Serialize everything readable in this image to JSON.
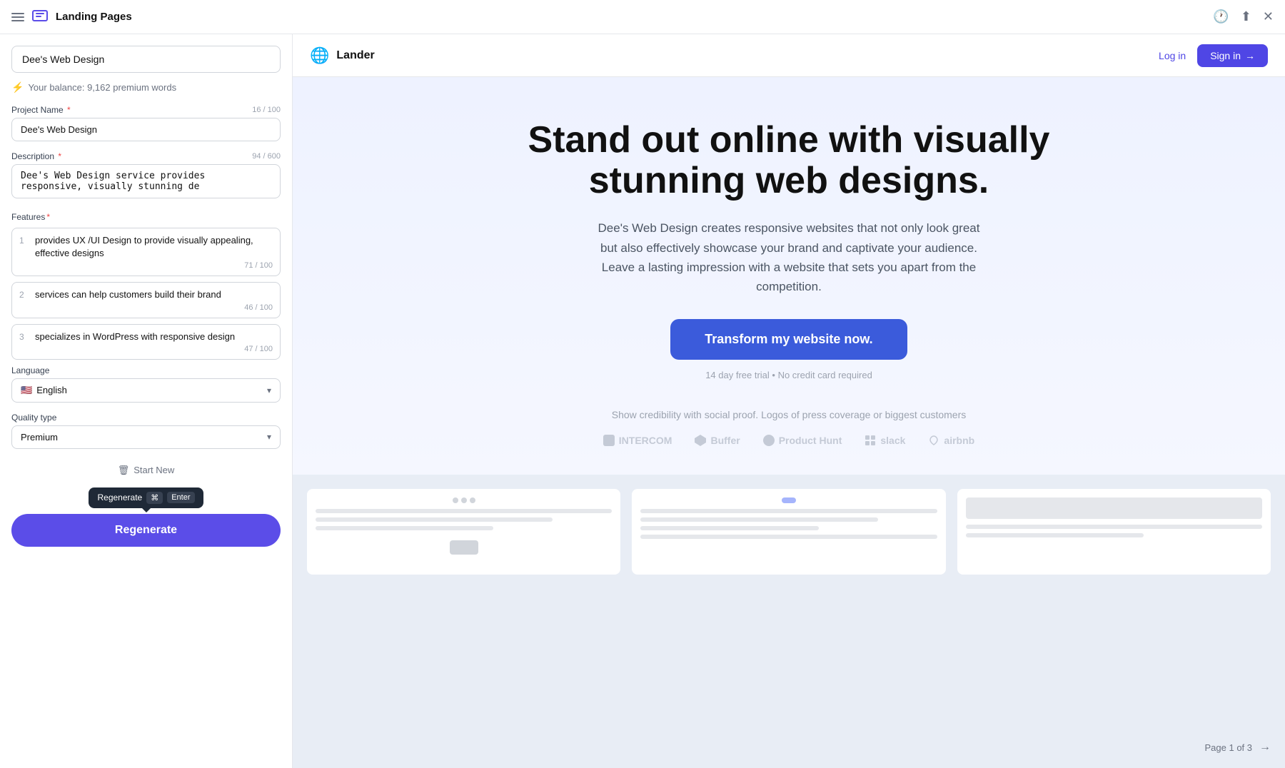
{
  "topBar": {
    "title": "Landing Pages",
    "icons": [
      "menu",
      "clock",
      "share",
      "close"
    ]
  },
  "leftPanel": {
    "projectNameDisplay": "Dee's Web Design",
    "balance": {
      "icon": "⚡",
      "text": "Your balance: 9,162 premium words"
    },
    "projectNameField": {
      "label": "Project Name",
      "required": true,
      "counter": "16 / 100",
      "value": "Dee's Web Design"
    },
    "descriptionField": {
      "label": "Description",
      "required": true,
      "counter": "94 / 600",
      "value": "Dee's Web Design service provides responsive, visually stunning de"
    },
    "featuresField": {
      "label": "Features",
      "required": true,
      "items": [
        {
          "num": 1,
          "text": "provides UX /UI Design to provide visually appealing, effective designs",
          "counter": "71 / 100"
        },
        {
          "num": 2,
          "text": "services can help customers build their brand",
          "counter": "46 / 100"
        },
        {
          "num": 3,
          "text": "specializes in WordPress with responsive design",
          "counter": "47 / 100"
        }
      ]
    },
    "languageField": {
      "label": "Language",
      "flag": "🇺🇸",
      "value": "English"
    },
    "qualityTypeField": {
      "label": "Quality type",
      "value": "Premium"
    },
    "startNewLabel": "Start New",
    "tooltip": {
      "label": "Regenerate",
      "key1": "⌘",
      "key2": "Enter"
    },
    "regenerateBtn": "Regenerate"
  },
  "previewNav": {
    "siteGlobe": "🌐",
    "siteName": "Lander",
    "loginLabel": "Log in",
    "signinLabel": "Sign in",
    "signinArrow": "→"
  },
  "hero": {
    "headline": "Stand out online with visually stunning web designs.",
    "subtext": "Dee's Web Design creates responsive websites that not only look great but also effectively showcase your brand and captivate your audience. Leave a lasting impression with a website that sets you apart from the competition.",
    "ctaLabel": "Transform my website now.",
    "disclaimer": "14 day free trial • No credit card required",
    "socialProofText": "Show credibility with social proof. Logos of press coverage or biggest customers",
    "logos": [
      "INTERCOM",
      "Buffer",
      "Product Hunt",
      "slack",
      "airbnb"
    ]
  },
  "pagination": {
    "label": "Page 1 of 3",
    "nextArrow": "→"
  }
}
